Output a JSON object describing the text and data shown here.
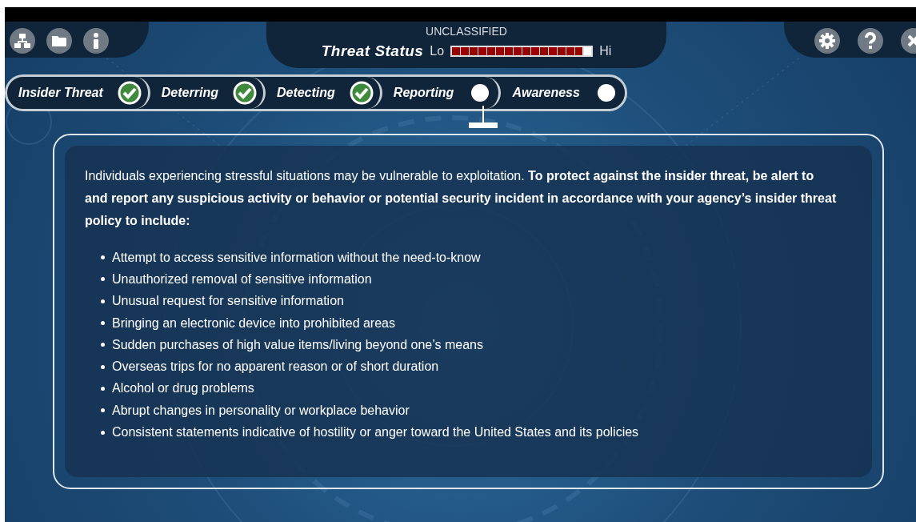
{
  "header": {
    "classification": "UNCLASSIFIED",
    "title": "Threat Status",
    "low_label": "Lo",
    "high_label": "Hi",
    "threat_meter": {
      "level": 0.9375
    }
  },
  "steps": [
    {
      "label": "Insider Threat",
      "completed": true,
      "selected": false
    },
    {
      "label": "Deterring",
      "completed": true,
      "selected": false
    },
    {
      "label": "Detecting",
      "completed": true,
      "selected": false
    },
    {
      "label": "Reporting",
      "completed": false,
      "selected": true
    },
    {
      "label": "Awareness",
      "completed": false,
      "selected": false
    }
  ],
  "content": {
    "intro": "Individuals experiencing stressful situations may be vulnerable to exploitation. **To protect against the insider threat, be alert to and report any suspicious activity or behavior or potential security incident in accordance with your agency’s insider threat policy to include:**",
    "bullets": [
      "Attempt to access sensitive information without the need-to-know",
      "Unauthorized removal of sensitive information",
      "Unusual request for sensitive information",
      "Bringing an electronic device into prohibited areas",
      "Sudden purchases of high value items/living beyond one’s means",
      "Overseas trips for no apparent reason or of short duration",
      "Alcohol or drug problems",
      "Abrupt changes in personality or workplace behavior",
      "Consistent statements indicative of hostility or anger toward the United States and its policies"
    ]
  }
}
